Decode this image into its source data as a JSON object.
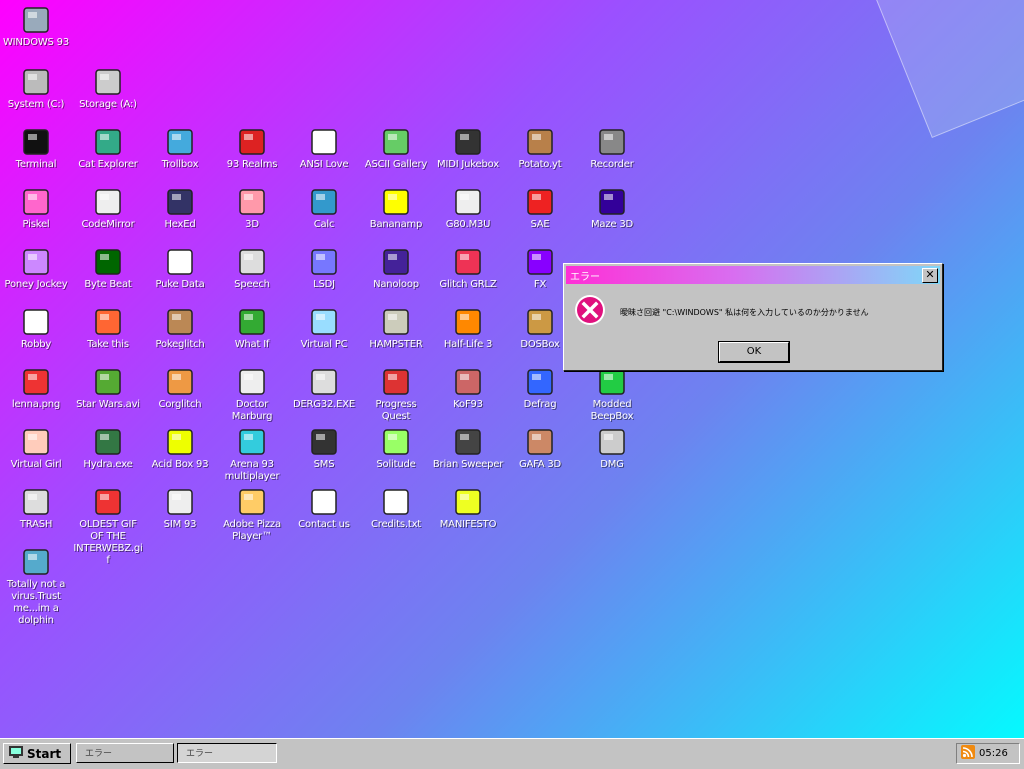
{
  "desktop": {
    "icons": [
      {
        "label": "WINDOWS 93",
        "icon": "computer-icon"
      },
      {
        "label": "System (C:)",
        "icon": "drive-icon"
      },
      {
        "label": "Storage (A:)",
        "icon": "floppy-drive-icon"
      },
      {
        "label": "Terminal",
        "icon": "terminal-icon"
      },
      {
        "label": "Cat Explorer",
        "icon": "cat-globe-icon"
      },
      {
        "label": "Trollbox",
        "icon": "chat-smiley-icon"
      },
      {
        "label": "93 Realms",
        "icon": "red-dice-icon"
      },
      {
        "label": "ANSI Love",
        "icon": "letter-a-icon"
      },
      {
        "label": "ASCII Gallery",
        "icon": "ascii-123-icon"
      },
      {
        "label": "MIDI Jukebox",
        "icon": "piano-icon"
      },
      {
        "label": "Potato.yt",
        "icon": "potato-icon"
      },
      {
        "label": "Recorder",
        "icon": "microphone-icon"
      },
      {
        "label": "Piskel",
        "icon": "palette-icon"
      },
      {
        "label": "CodeMirror",
        "icon": "unicorn-icon"
      },
      {
        "label": "HexEd",
        "icon": "cube-icon"
      },
      {
        "label": "3D",
        "icon": "teapot-icon"
      },
      {
        "label": "Calc",
        "icon": "calculator-icon"
      },
      {
        "label": "Bananamp",
        "icon": "banana-icon"
      },
      {
        "label": "G80.M3U",
        "icon": "speaker-file-icon"
      },
      {
        "label": "SAE",
        "icon": "boing-ball-icon"
      },
      {
        "label": "Maze 3D",
        "icon": "maze-icon"
      },
      {
        "label": "Poney Jockey",
        "icon": "pony-icon"
      },
      {
        "label": "Byte Beat",
        "icon": "bytebeat-icon"
      },
      {
        "label": "Puke Data",
        "icon": "pd-icon"
      },
      {
        "label": "Speech",
        "icon": "face-speech-icon"
      },
      {
        "label": "LSDJ",
        "icon": "lsdj-icon"
      },
      {
        "label": "Nanoloop",
        "icon": "waveform-icon"
      },
      {
        "label": "Glitch GRLZ",
        "icon": "lips-icon"
      },
      {
        "label": "FX",
        "icon": "atom-icon"
      },
      {
        "label": "Robby",
        "icon": "stick-figure-icon"
      },
      {
        "label": "Take this",
        "icon": "pixel-character-icon"
      },
      {
        "label": "Pokeglitch",
        "icon": "pokeball-icon"
      },
      {
        "label": "What If",
        "icon": "bars-icon"
      },
      {
        "label": "Virtual PC",
        "icon": "virtual-pc-icon"
      },
      {
        "label": "HAMPSTER",
        "icon": "owl-icon"
      },
      {
        "label": "Half-Life 3",
        "icon": "lambda-icon"
      },
      {
        "label": "DOSBox",
        "icon": "dosbox-icon"
      },
      {
        "label": "lenna.png",
        "icon": "image-file-icon"
      },
      {
        "label": "Star Wars.avi",
        "icon": "yoda-icon"
      },
      {
        "label": "Corglitch",
        "icon": "corgi-icon"
      },
      {
        "label": "Doctor Marburg",
        "icon": "doctor-icon"
      },
      {
        "label": "DERG32.EXE",
        "icon": "monitor-face-icon"
      },
      {
        "label": "Progress Quest",
        "icon": "crossed-swords-icon"
      },
      {
        "label": "KoF93",
        "icon": "fighter-icon"
      },
      {
        "label": "Defrag",
        "icon": "defrag-icon"
      },
      {
        "label": "Modded BeepBox",
        "icon": "ring-icon"
      },
      {
        "label": "Virtual Girl",
        "icon": "girl-face-icon"
      },
      {
        "label": "Hydra.exe",
        "icon": "hydra-icon"
      },
      {
        "label": "Acid Box 93",
        "icon": "acid-smiley-icon"
      },
      {
        "label": "Arena 93 multiplayer",
        "icon": "arena-cube-icon"
      },
      {
        "label": "SMS",
        "icon": "sms-console-icon"
      },
      {
        "label": "Solitude",
        "icon": "bottle-icon"
      },
      {
        "label": "Brian Sweeper",
        "icon": "mine-icon"
      },
      {
        "label": "GAFA 3D",
        "icon": "doom-face-icon"
      },
      {
        "label": "DMG",
        "icon": "gameboy-icon"
      },
      {
        "label": "TRASH",
        "icon": "trash-icon"
      },
      {
        "label": "OLDEST GIF OF THE INTERWEBZ.gif",
        "icon": "gif-file-icon"
      },
      {
        "label": "SIM 93",
        "icon": "book-icon"
      },
      {
        "label": "Adobe Pizza Player™",
        "icon": "pizza-icon"
      },
      {
        "label": "Contact us",
        "icon": "contact-icon"
      },
      {
        "label": "Credits.txt",
        "icon": "text-file-icon"
      },
      {
        "label": "MANIFESTO",
        "icon": "question-mark-icon"
      },
      {
        "label": "Totally not a virus.Trust me...im a dolphin",
        "icon": "dolphin-shortcut-icon"
      }
    ]
  },
  "dialog": {
    "title": "エラー",
    "icon": "error-x-icon",
    "message": "曖昧さ回避 \"C:\\WINDOWS\" 私は何を入力しているのか分かりません",
    "ok_label": "OK",
    "close_label": "✕"
  },
  "taskbar": {
    "start_label": "Start",
    "windows": [
      "エラー",
      "エラー"
    ],
    "clock": "05:26",
    "tray_icon": "rss-icon"
  },
  "colors": {
    "desktop_gradient": [
      "#ff00ff",
      "#9b50ff",
      "#6d83f0",
      "#00ffff"
    ],
    "dialog_title_gradient": [
      "#ff2fd6",
      "#7fd8f8"
    ],
    "error_icon": "#e0107e",
    "chrome_gray": "#c3c3c3"
  }
}
